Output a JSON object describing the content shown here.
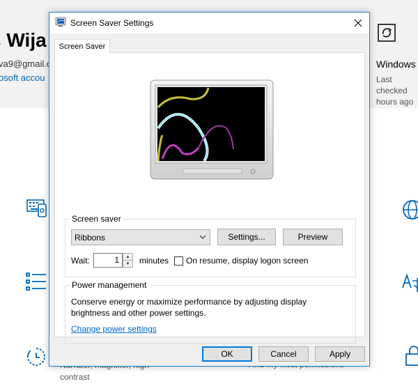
{
  "background": {
    "user_name": "s Wija",
    "email": "va9@gmail.c",
    "account_link": "osoft accou",
    "windows_title": "Windows",
    "last_checked": "Last checked hours ago",
    "left_item_text_1": "Narrator, magnifier, high",
    "left_item_text_2": "contrast",
    "right_item_text": "Find my files, permissions"
  },
  "dialog": {
    "title": "Screen Saver Settings",
    "tab_label": "Screen Saver",
    "screen_saver_group": "Screen saver",
    "selected_saver": "Ribbons",
    "settings_label": "Settings...",
    "preview_label": "Preview",
    "wait_label": "Wait:",
    "wait_value": "1",
    "minutes_label": "minutes",
    "resume_checkbox_label": "On resume, display logon screen",
    "resume_checked": false,
    "power_group": "Power management",
    "power_description": "Conserve energy or maximize performance by adjusting display brightness and other power settings.",
    "power_link": "Change power settings",
    "ok_label": "OK",
    "cancel_label": "Cancel",
    "apply_label": "Apply"
  },
  "colors": {
    "accent": "#0078d7",
    "link": "#0066cc",
    "dialog_border": "#1883d7"
  },
  "icons": [
    "update-icon",
    "screen-saver-app-icon",
    "close-icon",
    "chevron-down-icon",
    "keyboard-device-icon",
    "list-icon",
    "globe-icon",
    "language-icon",
    "timer-icon",
    "lock-icon"
  ]
}
